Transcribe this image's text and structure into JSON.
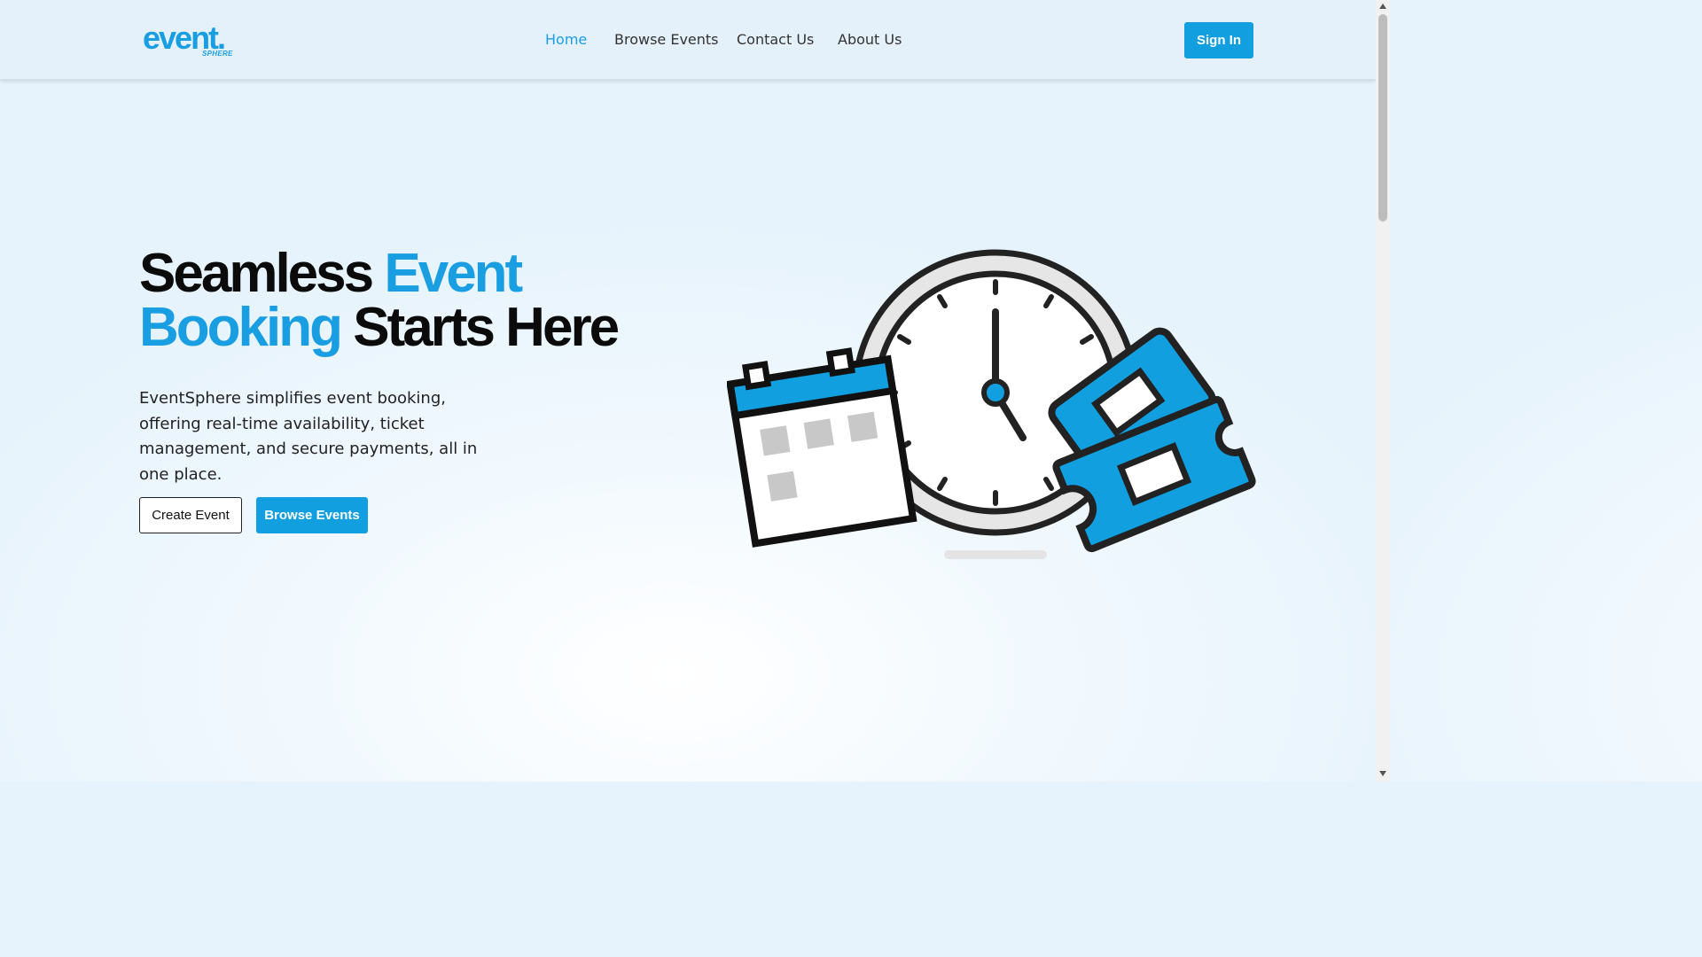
{
  "header": {
    "logo_text": "event.",
    "logo_subtext": "SPHERE",
    "nav": [
      {
        "label": "Home",
        "active": true
      },
      {
        "label": "Browse Events",
        "active": false
      },
      {
        "label": "Contact Us",
        "active": false
      },
      {
        "label": "About Us",
        "active": false
      }
    ],
    "signin_label": "Sign In"
  },
  "hero": {
    "headline": {
      "part1": "Seamless",
      "part2": "Event",
      "part3": "Booking",
      "part4": "Starts Here"
    },
    "description": "EventSphere simplifies event booking, offering real-time availability, ticket management, and secure payments, all in one place.",
    "create_label": "Create Event",
    "browse_label": "Browse Events"
  },
  "illustration": {
    "icons": [
      "clock-icon",
      "calendar-icon",
      "ticket-icon"
    ]
  },
  "colors": {
    "accent": "#129fe0",
    "heading": "#0b0b0b",
    "background": "#e6f3fc"
  }
}
